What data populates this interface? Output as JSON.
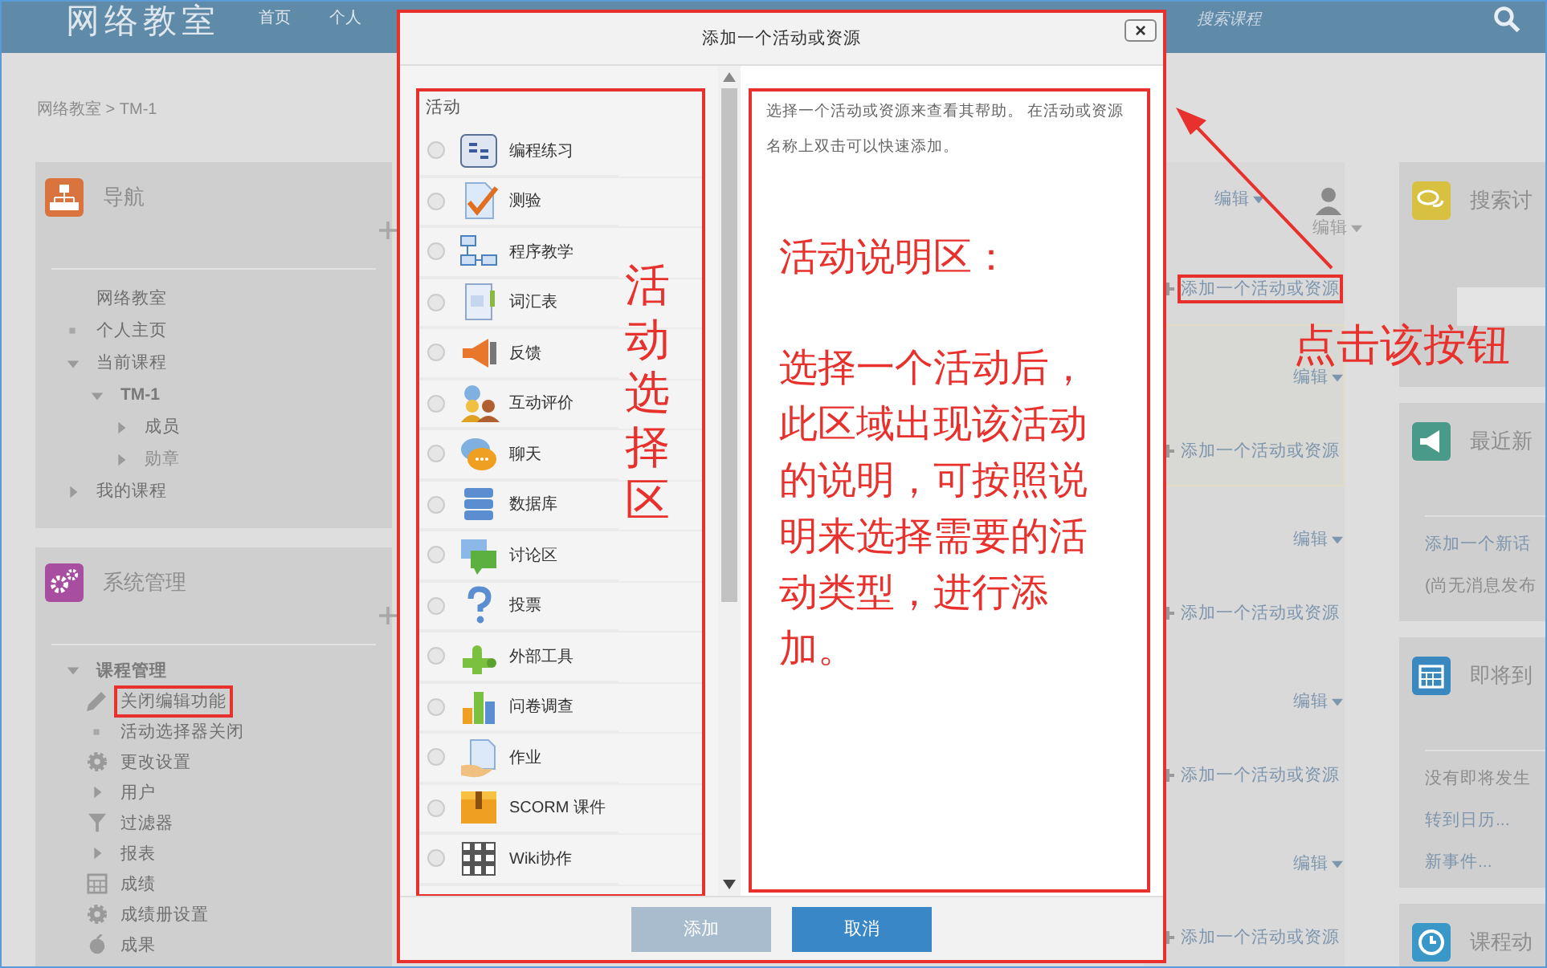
{
  "header": {
    "site_title": "网络教室",
    "nav": [
      "首页",
      "个人"
    ],
    "search_placeholder": "搜索课程"
  },
  "breadcrumb": "网络教室 > TM-1",
  "navigation": {
    "title": "导航",
    "items": [
      {
        "label": "网络教室",
        "kind": "plain",
        "disabled": false
      },
      {
        "label": "个人主页",
        "kind": "leaf",
        "disabled": false
      },
      {
        "label": "当前课程",
        "kind": "branch",
        "expanded": true,
        "disabled": false,
        "children": [
          {
            "label": "TM-1",
            "kind": "branch",
            "expanded": true,
            "disabled": false,
            "children": [
              {
                "label": "成员",
                "kind": "branch",
                "expanded": false,
                "disabled": false
              },
              {
                "label": "勋章",
                "kind": "branch",
                "expanded": false,
                "disabled": true
              }
            ]
          }
        ]
      },
      {
        "label": "我的课程",
        "kind": "branch",
        "expanded": false,
        "disabled": false
      }
    ]
  },
  "administration": {
    "title": "系统管理",
    "items": [
      {
        "label": "课程管理",
        "kind": "branch",
        "expanded": true,
        "children": [
          {
            "label": "关闭编辑功能",
            "kind": "pencil",
            "annotated": true
          },
          {
            "label": "活动选择器关闭",
            "kind": "leaf",
            "annotated": false
          },
          {
            "label": "更改设置",
            "kind": "gear",
            "annotated": false
          },
          {
            "label": "用户",
            "kind": "branch",
            "expanded": false,
            "annotated": false
          },
          {
            "label": "过滤器",
            "kind": "filter",
            "annotated": false
          },
          {
            "label": "报表",
            "kind": "branch",
            "expanded": false,
            "annotated": false
          },
          {
            "label": "成绩",
            "kind": "table",
            "annotated": false
          },
          {
            "label": "成绩册设置",
            "kind": "gear",
            "annotated": false
          },
          {
            "label": "成果",
            "kind": "outcome",
            "annotated": false
          }
        ]
      }
    ]
  },
  "course_sections": [
    {
      "edit_label": "编辑",
      "secondary_edit_label": "编辑",
      "add_label": "添加一个活动或资源",
      "highlighted": false,
      "annotated": true
    },
    {
      "edit_label": "编辑",
      "add_label": "添加一个活动或资源",
      "highlighted": true,
      "annotated": false
    },
    {
      "edit_label": "编辑",
      "add_label": "添加一个活动或资源",
      "highlighted": false,
      "annotated": false
    },
    {
      "edit_label": "编辑",
      "add_label": "添加一个活动或资源",
      "highlighted": false,
      "annotated": false
    },
    {
      "edit_label": "编辑",
      "add_label": "添加一个活动或资源",
      "highlighted": false,
      "annotated": false
    }
  ],
  "blocks": [
    {
      "kind": "search",
      "title": "搜索讨"
    },
    {
      "kind": "news",
      "title": "最近新",
      "lines": [
        {
          "text": "添加一个新话",
          "kind": "link"
        },
        {
          "text": "(尚无消息发布",
          "kind": "text"
        }
      ]
    },
    {
      "kind": "calendar",
      "title": "即将到",
      "lines": [
        {
          "text": "没有即将发生",
          "kind": "text"
        },
        {
          "text": "转到日历...",
          "kind": "link"
        },
        {
          "text": "新事件...",
          "kind": "link"
        }
      ]
    },
    {
      "kind": "recent",
      "title": "课程动"
    }
  ],
  "dialog": {
    "title": "添加一个活动或资源",
    "close": "×",
    "section_label": "活动",
    "activities": [
      {
        "label": "编程练习",
        "kind": "code",
        "selected": false
      },
      {
        "label": "测验",
        "kind": "quiz",
        "selected": false
      },
      {
        "label": "程序教学",
        "kind": "lesson",
        "selected": false
      },
      {
        "label": "词汇表",
        "kind": "glossary",
        "selected": false
      },
      {
        "label": "反馈",
        "kind": "feedback",
        "selected": false
      },
      {
        "label": "互动评价",
        "kind": "workshop",
        "selected": false
      },
      {
        "label": "聊天",
        "kind": "chat",
        "selected": false
      },
      {
        "label": "数据库",
        "kind": "database",
        "selected": false
      },
      {
        "label": "讨论区",
        "kind": "forum",
        "selected": false
      },
      {
        "label": "投票",
        "kind": "choice",
        "selected": false
      },
      {
        "label": "外部工具",
        "kind": "tool",
        "selected": false
      },
      {
        "label": "问卷调查",
        "kind": "survey",
        "selected": false
      },
      {
        "label": "作业",
        "kind": "assignment",
        "selected": false
      },
      {
        "label": "SCORM 课件",
        "kind": "scorm",
        "selected": false
      },
      {
        "label": "Wiki协作",
        "kind": "wiki",
        "selected": false
      }
    ],
    "help_text": "选择一个活动或资源来查看其帮助。 在活动或资源名称上双击可以快速添加。",
    "buttons": [
      {
        "label": "添加",
        "disabled": true
      },
      {
        "label": "取消",
        "disabled": false
      }
    ]
  },
  "annotations": {
    "list_label": "活动选择区",
    "help_title": "活动说明区：",
    "help_body": "选择一个活动后，此区域出现该活动的说明，可按照说明来选择需要的活动类型，进行添加。",
    "click_hint": "点击该按钮"
  }
}
